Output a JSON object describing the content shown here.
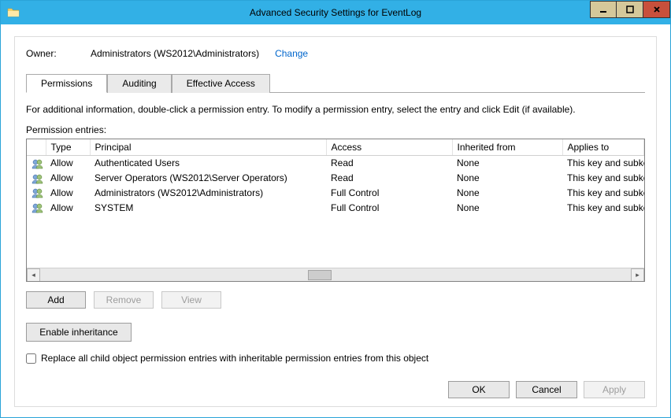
{
  "window": {
    "title": "Advanced Security Settings for EventLog"
  },
  "owner": {
    "label": "Owner:",
    "value": "Administrators (WS2012\\Administrators)",
    "change": "Change"
  },
  "tabs": {
    "permissions": "Permissions",
    "auditing": "Auditing",
    "effective": "Effective Access"
  },
  "instruction": "For additional information, double-click a permission entry. To modify a permission entry, select the entry and click Edit (if available).",
  "entries_label": "Permission entries:",
  "columns": {
    "type": "Type",
    "principal": "Principal",
    "access": "Access",
    "inherited": "Inherited from",
    "applies": "Applies to"
  },
  "entries": [
    {
      "type": "Allow",
      "principal": "Authenticated Users",
      "access": "Read",
      "inherited": "None",
      "applies": "This key and subkeys"
    },
    {
      "type": "Allow",
      "principal": "Server Operators (WS2012\\Server Operators)",
      "access": "Read",
      "inherited": "None",
      "applies": "This key and subkeys"
    },
    {
      "type": "Allow",
      "principal": "Administrators (WS2012\\Administrators)",
      "access": "Full Control",
      "inherited": "None",
      "applies": "This key and subkeys"
    },
    {
      "type": "Allow",
      "principal": "SYSTEM",
      "access": "Full Control",
      "inherited": "None",
      "applies": "This key and subkeys"
    }
  ],
  "buttons": {
    "add": "Add",
    "remove": "Remove",
    "view": "View",
    "enable_inheritance": "Enable inheritance",
    "ok": "OK",
    "cancel": "Cancel",
    "apply": "Apply"
  },
  "checkbox": {
    "label": "Replace all child object permission entries with inheritable permission entries from this object"
  }
}
